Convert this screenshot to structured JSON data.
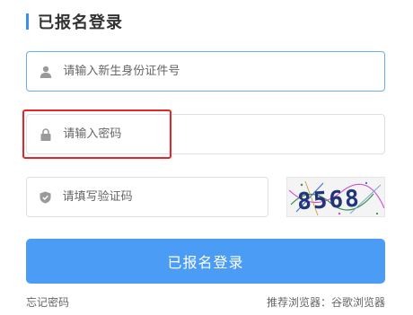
{
  "title": "已报名登录",
  "colors": {
    "accent": "#3b8df0",
    "button": "#4a9cf5",
    "highlight": "#e5252a"
  },
  "fields": {
    "id": {
      "placeholder": "请输入新生身份证件号",
      "icon": "user-icon"
    },
    "password": {
      "placeholder": "请输入密码",
      "icon": "lock-icon"
    },
    "captcha": {
      "placeholder": "请填写验证码",
      "icon": "shield-icon"
    }
  },
  "captcha_text": "8568",
  "submit_label": "已报名登录",
  "forgot_label": "忘记密码",
  "browser_note": "推荐浏览器：谷歌浏览器"
}
